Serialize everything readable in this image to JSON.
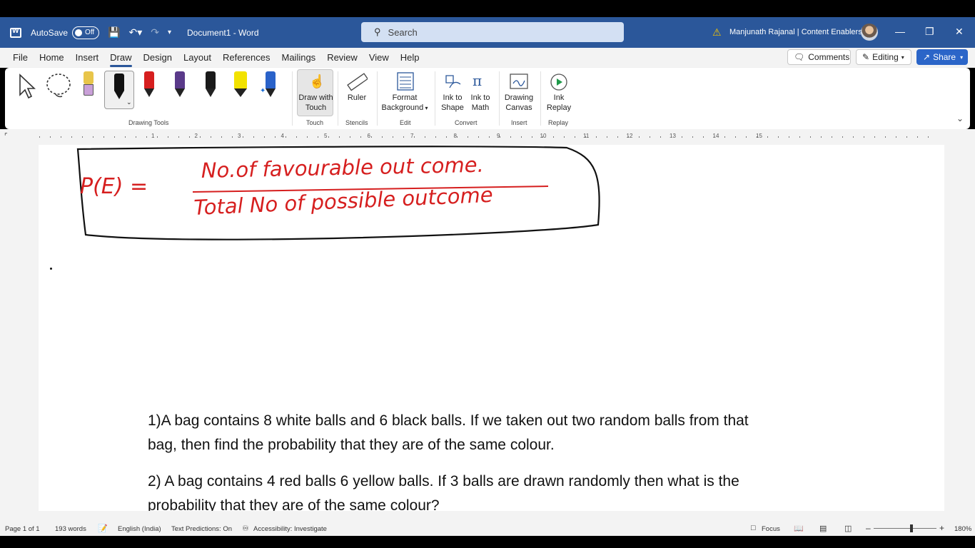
{
  "titlebar": {
    "autosave_label": "AutoSave",
    "autosave_state": "Off",
    "doc_title": "Document1  -  Word",
    "search_placeholder": "Search",
    "user_name": "Manjunath Rajanal | Content Enablers"
  },
  "menu": {
    "tabs": [
      "File",
      "Home",
      "Insert",
      "Draw",
      "Design",
      "Layout",
      "References",
      "Mailings",
      "Review",
      "View",
      "Help"
    ],
    "active": "Draw",
    "comments_label": "Comments",
    "editing_label": "Editing",
    "share_label": "Share"
  },
  "ribbon": {
    "groups": {
      "drawing_tools": "Drawing Tools",
      "touch": "Touch",
      "stencils": "Stencils",
      "edit": "Edit",
      "convert": "Convert",
      "insert": "Insert",
      "replay": "Replay"
    },
    "tools": {
      "draw_with_touch_1": "Draw with",
      "draw_with_touch_2": "Touch",
      "ruler": "Ruler",
      "format_bg_1": "Format",
      "format_bg_2": "Background",
      "ink_to_shape_1": "Ink to",
      "ink_to_shape_2": "Shape",
      "ink_to_math_1": "Ink to",
      "ink_to_math_2": "Math",
      "drawing_canvas_1": "Drawing",
      "drawing_canvas_2": "Canvas",
      "ink_replay_1": "Ink",
      "ink_replay_2": "Replay"
    },
    "pen_colors": [
      "#e8c54a",
      "#1a1a1a",
      "#d61f1f",
      "#5a3a8a",
      "#1a1a1a",
      "#f2e200",
      "#2a62c9"
    ]
  },
  "ruler": {
    "numbers": [
      "1",
      "2",
      "3",
      "4",
      "5",
      "6",
      "7",
      "8",
      "9",
      "10",
      "11",
      "12",
      "13",
      "14",
      "15"
    ]
  },
  "document": {
    "ink_formula_lhs": "P(E) =",
    "ink_numerator": "No.of favourable out come.",
    "ink_denominator": "Total No of possible outcome",
    "q1_line1": "1)A bag contains 8 white balls and 6 black balls. If we taken out two random balls from that",
    "q1_line2": "bag, then find the probability that they are of the same colour.",
    "q2_line1": "2) A bag contains 4 red balls 6 yellow balls. If 3 balls are drawn randomly then what is the",
    "q2_line2": "probability that they are of the same colour?"
  },
  "status": {
    "page": "Page 1 of 1",
    "words": "193 words",
    "language": "English (India)",
    "text_predictions": "Text Predictions: On",
    "accessibility": "Accessibility: Investigate",
    "focus": "Focus",
    "zoom": "180%"
  }
}
